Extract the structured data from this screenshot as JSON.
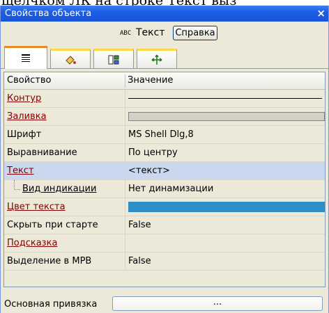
{
  "caption": "щелчком ЛК на строке Текст выз",
  "window": {
    "title": "Свойства объекта",
    "close_glyph": "×"
  },
  "object": {
    "type_icon_text": "ABC",
    "type_name": "Текст",
    "help_label": "Справка"
  },
  "tabs": [
    {
      "icon": "list-icon",
      "active": true
    },
    {
      "icon": "paint-icon",
      "active": false
    },
    {
      "icon": "binding-icon",
      "active": false
    },
    {
      "icon": "move-icon",
      "active": false
    }
  ],
  "grid": {
    "col_property": "Свойство",
    "col_value": "Значение",
    "rows": [
      {
        "name": "Контур",
        "value": "",
        "kind": "line"
      },
      {
        "name": "Заливка",
        "value": "",
        "kind": "fill",
        "color": "#d4d0c8"
      },
      {
        "name": "Шрифт",
        "value": "MS Shell Dlg,8",
        "kind": "text"
      },
      {
        "name": "Выравнивание",
        "value": "По центру",
        "kind": "text"
      },
      {
        "name": "Текст",
        "value": "<текст>",
        "kind": "text",
        "selected": true
      },
      {
        "name": "Вид индикации",
        "value": "Нет динамизации",
        "kind": "text",
        "child": true
      },
      {
        "name": "Цвет текста",
        "value": "",
        "kind": "color",
        "color": "#2e8fc6"
      },
      {
        "name": "Скрыть при старте",
        "value": "False",
        "kind": "text"
      },
      {
        "name": "Подсказка",
        "value": "",
        "kind": "text"
      },
      {
        "name": "Выделение в МРВ",
        "value": "False",
        "kind": "text"
      }
    ]
  },
  "bottom": {
    "label": "Основная привязка",
    "button_text": "..."
  }
}
